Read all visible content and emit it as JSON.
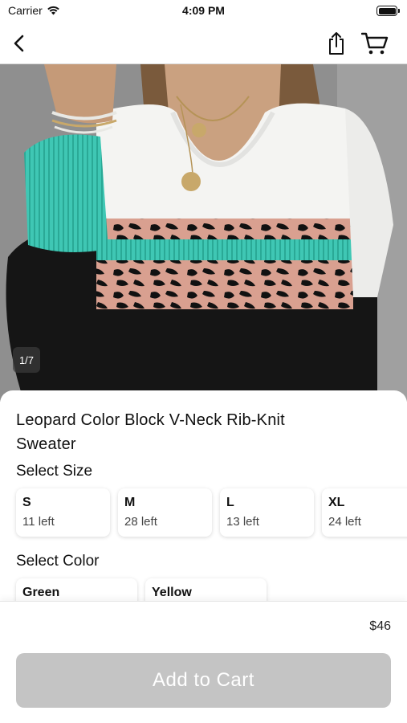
{
  "status_bar": {
    "carrier": "Carrier",
    "time": "4:09 PM"
  },
  "nav": {
    "back_icon": "chevron-left-icon",
    "share_icon": "share-icon",
    "cart_icon": "cart-icon"
  },
  "gallery": {
    "counter": "1/7",
    "current_image": 1,
    "total_images": 7
  },
  "product": {
    "title": "Leopard Color Block V-Neck Rib-Knit Sweater",
    "size_label": "Select Size",
    "sizes": [
      {
        "name": "S",
        "stock": "11 left"
      },
      {
        "name": "M",
        "stock": "28 left"
      },
      {
        "name": "L",
        "stock": "13 left"
      },
      {
        "name": "XL",
        "stock": "24 left"
      }
    ],
    "color_label": "Select Color",
    "colors": [
      {
        "name": "Green"
      },
      {
        "name": "Yellow"
      }
    ]
  },
  "bottom": {
    "price": "$46",
    "add_to_cart_label": "Add to Cart",
    "button_color": "#c4c4c4"
  }
}
